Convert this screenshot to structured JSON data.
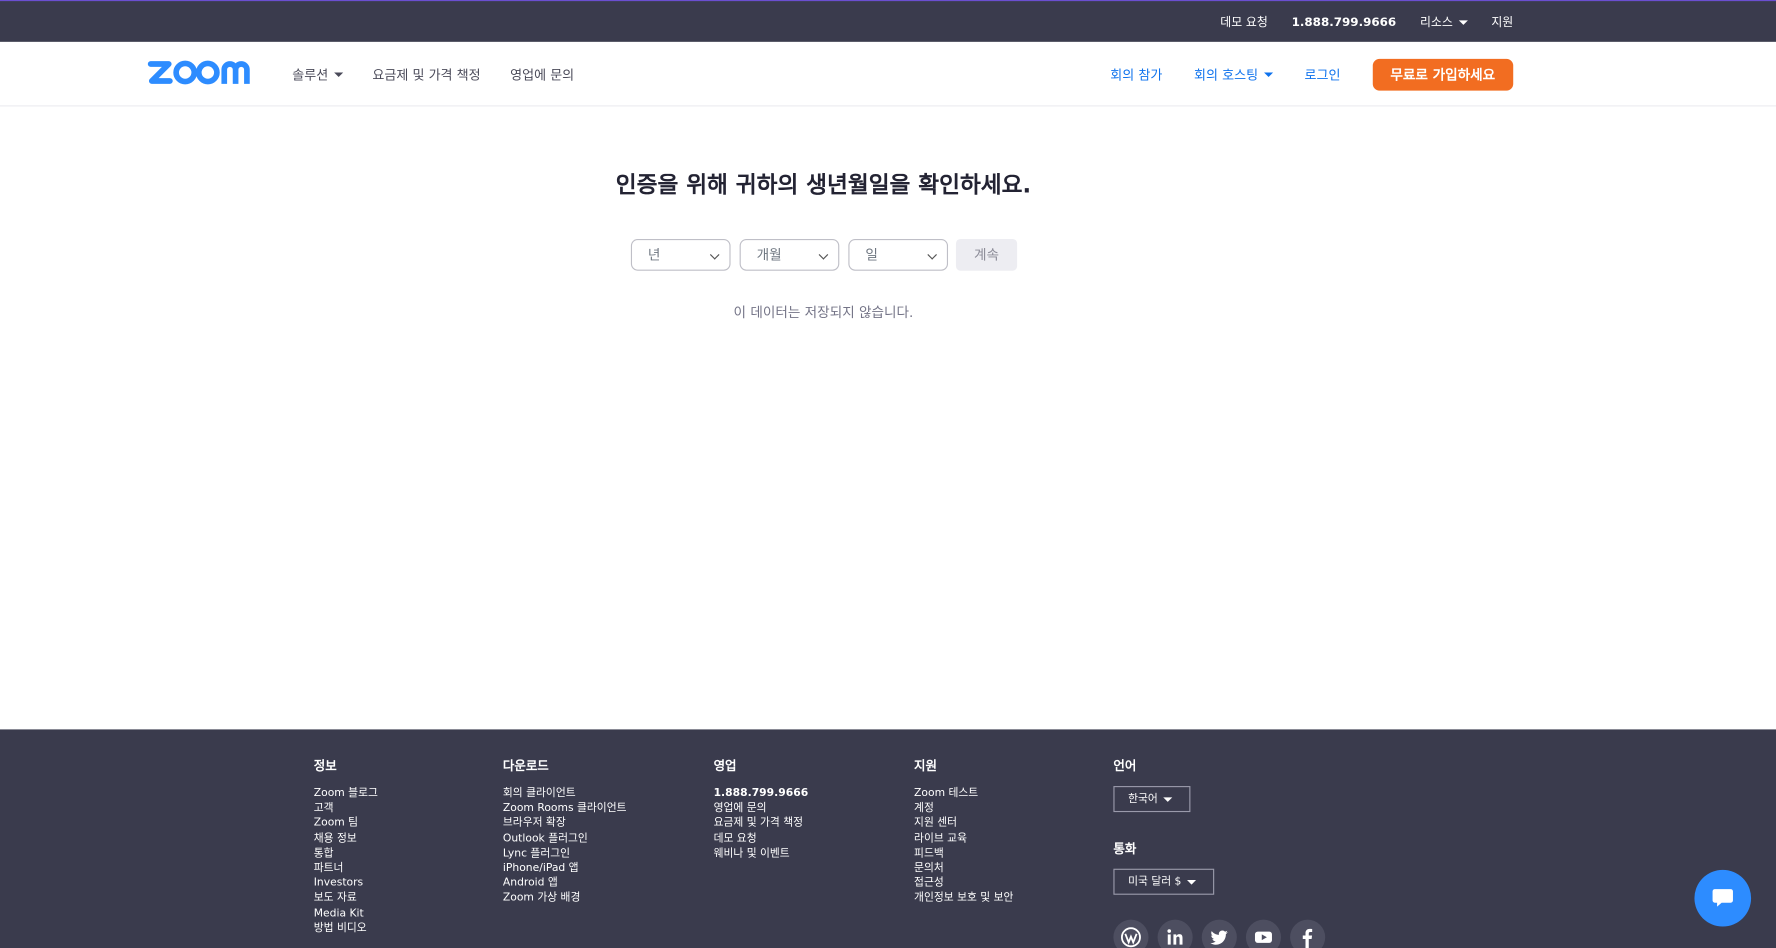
{
  "topbar": {
    "demo": "데모 요청",
    "phone": "1.888.799.9666",
    "resources": "리소스",
    "support": "지원"
  },
  "nav": {
    "solutions": "솔루션",
    "pricing": "요금제 및 가격 책정",
    "contact_sales": "영업에 문의",
    "join": "회의 참가",
    "host": "회의 호스팅",
    "signin": "로그인",
    "signup": "무료로 가입하세요"
  },
  "main": {
    "heading": "인증을 위해 귀하의 생년월일을 확인하세요.",
    "year_placeholder": "년",
    "month_placeholder": "개월",
    "day_placeholder": "일",
    "continue": "계속",
    "note": "이 데이터는 저장되지 않습니다."
  },
  "footer": {
    "about": {
      "title": "정보",
      "links": [
        "Zoom 블로그",
        "고객",
        "Zoom 팀",
        "채용 정보",
        "통합",
        "파트너",
        "Investors",
        "보도 자료",
        "Media Kit",
        "방법 비디오"
      ]
    },
    "download": {
      "title": "다운로드",
      "links": [
        "회의 클라이언트",
        "Zoom Rooms 클라이언트",
        "브라우저 확장",
        "Outlook 플러그인",
        "Lync 플러그인",
        "iPhone/iPad 앱",
        "Android 앱",
        "Zoom 가상 배경"
      ]
    },
    "sales": {
      "title": "영업",
      "links": [
        "1.888.799.9666",
        "영업에 문의",
        "요금제 및 가격 책정",
        "데모 요청",
        "웨비나 및 이벤트"
      ]
    },
    "support": {
      "title": "지원",
      "links": [
        "Zoom 테스트",
        "계정",
        "지원 센터",
        "라이브 교육",
        "피드백",
        "문의처",
        "접근성",
        "개인정보 보호 및 보안"
      ]
    },
    "language": {
      "title": "언어",
      "value": "한국어"
    },
    "currency": {
      "title": "통화",
      "value": "미국 달러 $"
    }
  },
  "colors": {
    "brand": "#2d8cff",
    "signup": "#f26d21",
    "dark": "#3a3b4d",
    "link": "#0e72ed"
  }
}
